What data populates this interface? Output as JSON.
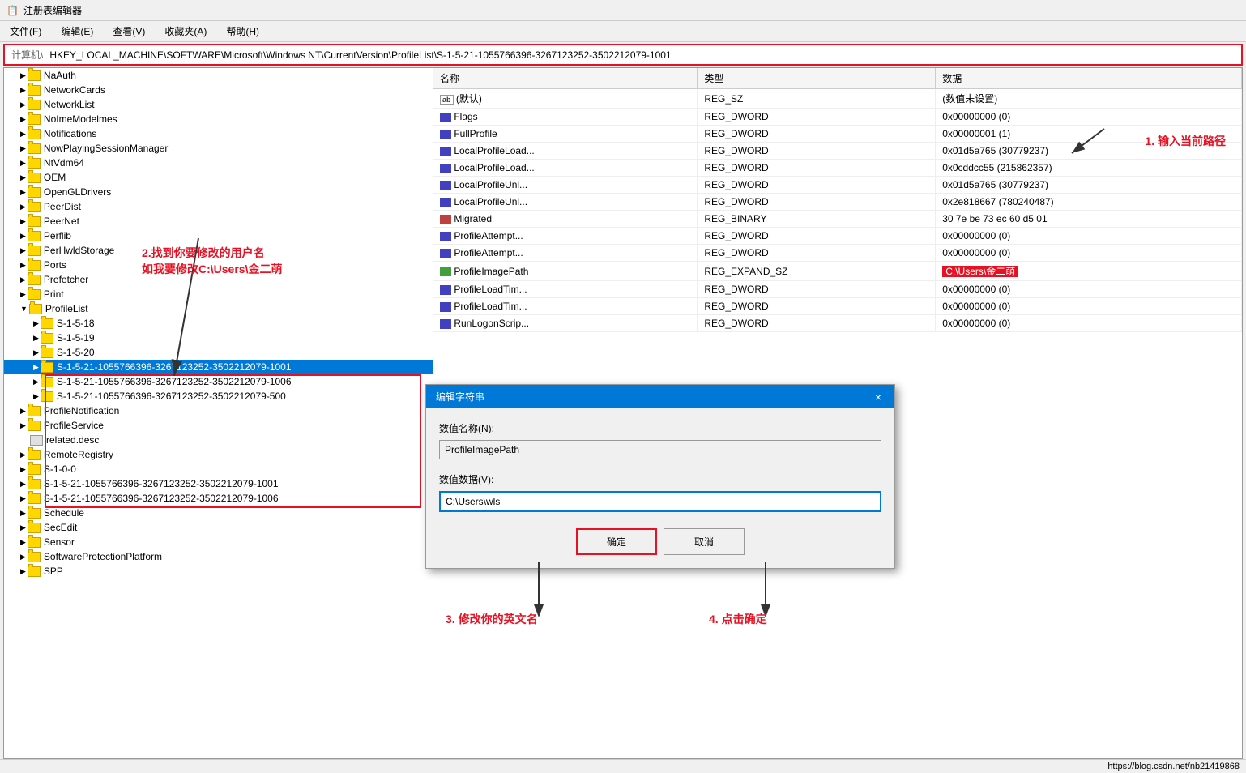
{
  "window": {
    "title": "注册表编辑器",
    "icon": "🗒️"
  },
  "menu": {
    "items": [
      "文件(F)",
      "编辑(E)",
      "查看(V)",
      "收藏夹(A)",
      "帮助(H)"
    ]
  },
  "address": {
    "label": "计算机\\",
    "value": "HKEY_LOCAL_MACHINE\\SOFTWARE\\Microsoft\\Windows NT\\CurrentVersion\\ProfileList\\S-1-5-21-1055766396-3267123252-3502212079-1001"
  },
  "tree": {
    "items": [
      {
        "id": "naauth",
        "label": "NaAuth",
        "indent": 1,
        "expanded": false,
        "type": "folder"
      },
      {
        "id": "networkcards",
        "label": "NetworkCards",
        "indent": 1,
        "expanded": false,
        "type": "folder"
      },
      {
        "id": "networklist",
        "label": "NetworkList",
        "indent": 1,
        "expanded": false,
        "type": "folder"
      },
      {
        "id": "noimemodelmes",
        "label": "NoImeModelmes",
        "indent": 1,
        "expanded": false,
        "type": "folder"
      },
      {
        "id": "notifications",
        "label": "Notifications",
        "indent": 1,
        "expanded": false,
        "type": "folder"
      },
      {
        "id": "nowplayingsessionmanager",
        "label": "NowPlayingSessionManager",
        "indent": 1,
        "expanded": false,
        "type": "folder"
      },
      {
        "id": "ntvdm64",
        "label": "NtVdm64",
        "indent": 1,
        "expanded": false,
        "type": "folder"
      },
      {
        "id": "oem",
        "label": "OEM",
        "indent": 1,
        "expanded": false,
        "type": "folder"
      },
      {
        "id": "opengl",
        "label": "OpenGLDrivers",
        "indent": 1,
        "expanded": false,
        "type": "folder"
      },
      {
        "id": "peerdist",
        "label": "PeerDist",
        "indent": 1,
        "expanded": false,
        "type": "folder"
      },
      {
        "id": "peernet",
        "label": "PeerNet",
        "indent": 1,
        "expanded": false,
        "type": "folder"
      },
      {
        "id": "perflib",
        "label": "Perflib",
        "indent": 1,
        "expanded": false,
        "type": "folder"
      },
      {
        "id": "perhwldstorage",
        "label": "PerHwldStorage",
        "indent": 1,
        "expanded": false,
        "type": "folder"
      },
      {
        "id": "ports",
        "label": "Ports",
        "indent": 1,
        "expanded": false,
        "type": "folder"
      },
      {
        "id": "prefetcher",
        "label": "Prefetcher",
        "indent": 1,
        "expanded": false,
        "type": "folder"
      },
      {
        "id": "print",
        "label": "Print",
        "indent": 1,
        "expanded": false,
        "type": "folder"
      },
      {
        "id": "profilelist",
        "label": "ProfileList",
        "indent": 1,
        "expanded": true,
        "type": "folder"
      },
      {
        "id": "s-1-5-18",
        "label": "S-1-5-18",
        "indent": 2,
        "expanded": false,
        "type": "folder"
      },
      {
        "id": "s-1-5-19",
        "label": "S-1-5-19",
        "indent": 2,
        "expanded": false,
        "type": "folder"
      },
      {
        "id": "s-1-5-20",
        "label": "S-1-5-20",
        "indent": 2,
        "expanded": false,
        "type": "folder"
      },
      {
        "id": "s-1-5-21-1001",
        "label": "S-1-5-21-1055766396-3267123252-3502212079-1001",
        "indent": 2,
        "expanded": false,
        "type": "folder",
        "selected": true
      },
      {
        "id": "s-1-5-21-1006",
        "label": "S-1-5-21-1055766396-3267123252-3502212079-1006",
        "indent": 2,
        "expanded": false,
        "type": "folder"
      },
      {
        "id": "s-1-5-21-500",
        "label": "S-1-5-21-1055766396-3267123252-3502212079-500",
        "indent": 2,
        "expanded": false,
        "type": "folder"
      },
      {
        "id": "profilenotification",
        "label": "ProfileNotification",
        "indent": 1,
        "expanded": false,
        "type": "folder"
      },
      {
        "id": "profileservice",
        "label": "ProfileService",
        "indent": 1,
        "expanded": false,
        "type": "folder"
      },
      {
        "id": "related",
        "label": "related.desc",
        "indent": 1,
        "expanded": false,
        "type": "file"
      },
      {
        "id": "remoteregistry",
        "label": "RemoteRegistry",
        "indent": 1,
        "expanded": false,
        "type": "folder"
      },
      {
        "id": "s-1-0-0",
        "label": "S-1-0-0",
        "indent": 1,
        "expanded": false,
        "type": "folder"
      },
      {
        "id": "s-1-5-21-b-1001",
        "label": "S-1-5-21-1055766396-3267123252-3502212079-1001",
        "indent": 1,
        "expanded": false,
        "type": "folder"
      },
      {
        "id": "s-1-5-21-b-1006",
        "label": "S-1-5-21-1055766396-3267123252-3502212079-1006",
        "indent": 1,
        "expanded": false,
        "type": "folder"
      },
      {
        "id": "schedule",
        "label": "Schedule",
        "indent": 1,
        "expanded": false,
        "type": "folder"
      },
      {
        "id": "secedit",
        "label": "SecEdit",
        "indent": 1,
        "expanded": false,
        "type": "folder"
      },
      {
        "id": "sensor",
        "label": "Sensor",
        "indent": 1,
        "expanded": false,
        "type": "folder"
      },
      {
        "id": "softwareprotection",
        "label": "SoftwareProtectionPlatform",
        "indent": 1,
        "expanded": false,
        "type": "folder"
      },
      {
        "id": "spp",
        "label": "SPP",
        "indent": 1,
        "expanded": false,
        "type": "folder"
      }
    ]
  },
  "registry_table": {
    "columns": [
      "名称",
      "类型",
      "数据"
    ],
    "rows": [
      {
        "icon": "ab",
        "name": "(默认)",
        "type": "REG_SZ",
        "data": "(数值未设置)"
      },
      {
        "icon": "dword",
        "name": "Flags",
        "type": "REG_DWORD",
        "data": "0x00000000 (0)"
      },
      {
        "icon": "dword",
        "name": "FullProfile",
        "type": "REG_DWORD",
        "data": "0x00000001 (1)"
      },
      {
        "icon": "dword",
        "name": "LocalProfileLoad...",
        "type": "REG_DWORD",
        "data": "0x01d5a765 (30779237)"
      },
      {
        "icon": "dword",
        "name": "LocalProfileLoad...",
        "type": "REG_DWORD",
        "data": "0x0cddcc55 (215862357)"
      },
      {
        "icon": "dword",
        "name": "LocalProfileUnl...",
        "type": "REG_DWORD",
        "data": "0x01d5a765 (30779237)"
      },
      {
        "icon": "dword",
        "name": "LocalProfileUnl...",
        "type": "REG_DWORD",
        "data": "0x2e818667 (780240487)"
      },
      {
        "icon": "binary",
        "name": "Migrated",
        "type": "REG_BINARY",
        "data": "30 7e be 73 ec 60 d5 01"
      },
      {
        "icon": "dword",
        "name": "ProfileAttempt...",
        "type": "REG_DWORD",
        "data": "0x00000000 (0)"
      },
      {
        "icon": "dword",
        "name": "ProfileAttempt...",
        "type": "REG_DWORD",
        "data": "0x00000000 (0)"
      },
      {
        "icon": "expand",
        "name": "ProfileImagePath",
        "type": "REG_EXPAND_SZ",
        "data": "C:\\Users\\金二萌",
        "highlighted": true
      },
      {
        "icon": "dword",
        "name": "ProfileLoadTim...",
        "type": "REG_DWORD",
        "data": "0x00000000 (0)"
      },
      {
        "icon": "dword",
        "name": "ProfileLoadTim...",
        "type": "REG_DWORD",
        "data": "0x00000000 (0)"
      },
      {
        "icon": "dword",
        "name": "RunLogonScrip...",
        "type": "REG_DWORD",
        "data": "0x00000000 (0)"
      }
    ]
  },
  "annotations": {
    "step1": "1. 输入当前路径",
    "step2_line1": "2.找到你要修改的用户名",
    "step2_line2": "如我要修改C:\\Users\\金二萌",
    "step3": "3. 修改你的英文名",
    "step4": "4. 点击确定"
  },
  "dialog": {
    "title": "编辑字符串",
    "close_btn": "×",
    "value_name_label": "数值名称(N):",
    "value_name": "ProfileImagePath",
    "value_data_label": "数值数据(V):",
    "value_data": "C:\\Users\\wls",
    "ok_btn": "确定",
    "cancel_btn": "取消"
  },
  "status_bar": {
    "text": "https://blog.csdn.net/nb21419868"
  }
}
